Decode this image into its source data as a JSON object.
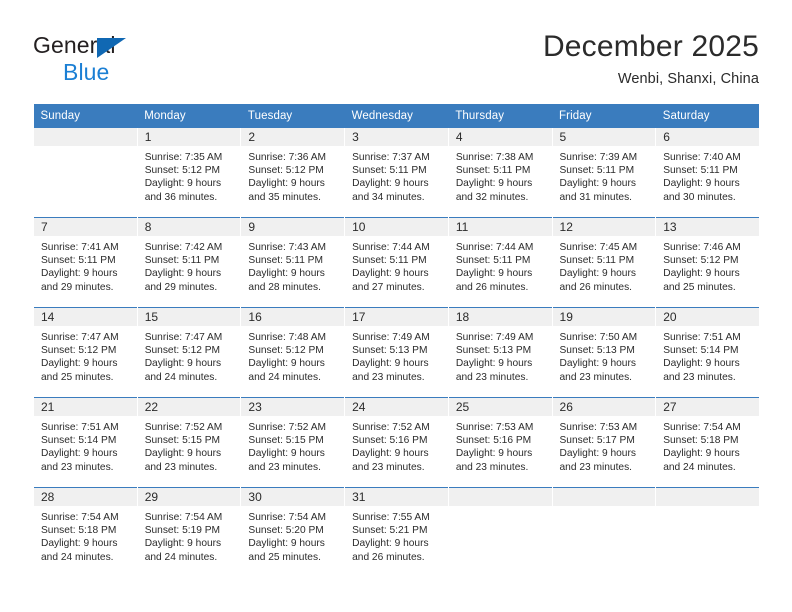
{
  "brand": {
    "line1": "General",
    "line2": "Blue",
    "triangle_color": "#1068b3",
    "text_color": "#231f20",
    "blue_color": "#1b7fd4"
  },
  "header": {
    "title": "December 2025",
    "subtitle": "Wenbi, Shanxi, China"
  },
  "theme": {
    "header_bg": "#3a7cbe",
    "header_text": "#ffffff",
    "daynum_bg": "#f0f0f0",
    "body_text": "#2b2b2b"
  },
  "weekday_headers": [
    "Sunday",
    "Monday",
    "Tuesday",
    "Wednesday",
    "Thursday",
    "Friday",
    "Saturday"
  ],
  "weeks": [
    [
      {
        "day": "",
        "empty": true,
        "sunrise": "",
        "sunset": "",
        "daylight_line1": "",
        "daylight_line2": ""
      },
      {
        "day": "1",
        "sunrise": "Sunrise: 7:35 AM",
        "sunset": "Sunset: 5:12 PM",
        "daylight_line1": "Daylight: 9 hours",
        "daylight_line2": "and 36 minutes."
      },
      {
        "day": "2",
        "sunrise": "Sunrise: 7:36 AM",
        "sunset": "Sunset: 5:12 PM",
        "daylight_line1": "Daylight: 9 hours",
        "daylight_line2": "and 35 minutes."
      },
      {
        "day": "3",
        "sunrise": "Sunrise: 7:37 AM",
        "sunset": "Sunset: 5:11 PM",
        "daylight_line1": "Daylight: 9 hours",
        "daylight_line2": "and 34 minutes."
      },
      {
        "day": "4",
        "sunrise": "Sunrise: 7:38 AM",
        "sunset": "Sunset: 5:11 PM",
        "daylight_line1": "Daylight: 9 hours",
        "daylight_line2": "and 32 minutes."
      },
      {
        "day": "5",
        "sunrise": "Sunrise: 7:39 AM",
        "sunset": "Sunset: 5:11 PM",
        "daylight_line1": "Daylight: 9 hours",
        "daylight_line2": "and 31 minutes."
      },
      {
        "day": "6",
        "sunrise": "Sunrise: 7:40 AM",
        "sunset": "Sunset: 5:11 PM",
        "daylight_line1": "Daylight: 9 hours",
        "daylight_line2": "and 30 minutes."
      }
    ],
    [
      {
        "day": "7",
        "sunrise": "Sunrise: 7:41 AM",
        "sunset": "Sunset: 5:11 PM",
        "daylight_line1": "Daylight: 9 hours",
        "daylight_line2": "and 29 minutes."
      },
      {
        "day": "8",
        "sunrise": "Sunrise: 7:42 AM",
        "sunset": "Sunset: 5:11 PM",
        "daylight_line1": "Daylight: 9 hours",
        "daylight_line2": "and 29 minutes."
      },
      {
        "day": "9",
        "sunrise": "Sunrise: 7:43 AM",
        "sunset": "Sunset: 5:11 PM",
        "daylight_line1": "Daylight: 9 hours",
        "daylight_line2": "and 28 minutes."
      },
      {
        "day": "10",
        "sunrise": "Sunrise: 7:44 AM",
        "sunset": "Sunset: 5:11 PM",
        "daylight_line1": "Daylight: 9 hours",
        "daylight_line2": "and 27 minutes."
      },
      {
        "day": "11",
        "sunrise": "Sunrise: 7:44 AM",
        "sunset": "Sunset: 5:11 PM",
        "daylight_line1": "Daylight: 9 hours",
        "daylight_line2": "and 26 minutes."
      },
      {
        "day": "12",
        "sunrise": "Sunrise: 7:45 AM",
        "sunset": "Sunset: 5:11 PM",
        "daylight_line1": "Daylight: 9 hours",
        "daylight_line2": "and 26 minutes."
      },
      {
        "day": "13",
        "sunrise": "Sunrise: 7:46 AM",
        "sunset": "Sunset: 5:12 PM",
        "daylight_line1": "Daylight: 9 hours",
        "daylight_line2": "and 25 minutes."
      }
    ],
    [
      {
        "day": "14",
        "sunrise": "Sunrise: 7:47 AM",
        "sunset": "Sunset: 5:12 PM",
        "daylight_line1": "Daylight: 9 hours",
        "daylight_line2": "and 25 minutes."
      },
      {
        "day": "15",
        "sunrise": "Sunrise: 7:47 AM",
        "sunset": "Sunset: 5:12 PM",
        "daylight_line1": "Daylight: 9 hours",
        "daylight_line2": "and 24 minutes."
      },
      {
        "day": "16",
        "sunrise": "Sunrise: 7:48 AM",
        "sunset": "Sunset: 5:12 PM",
        "daylight_line1": "Daylight: 9 hours",
        "daylight_line2": "and 24 minutes."
      },
      {
        "day": "17",
        "sunrise": "Sunrise: 7:49 AM",
        "sunset": "Sunset: 5:13 PM",
        "daylight_line1": "Daylight: 9 hours",
        "daylight_line2": "and 23 minutes."
      },
      {
        "day": "18",
        "sunrise": "Sunrise: 7:49 AM",
        "sunset": "Sunset: 5:13 PM",
        "daylight_line1": "Daylight: 9 hours",
        "daylight_line2": "and 23 minutes."
      },
      {
        "day": "19",
        "sunrise": "Sunrise: 7:50 AM",
        "sunset": "Sunset: 5:13 PM",
        "daylight_line1": "Daylight: 9 hours",
        "daylight_line2": "and 23 minutes."
      },
      {
        "day": "20",
        "sunrise": "Sunrise: 7:51 AM",
        "sunset": "Sunset: 5:14 PM",
        "daylight_line1": "Daylight: 9 hours",
        "daylight_line2": "and 23 minutes."
      }
    ],
    [
      {
        "day": "21",
        "sunrise": "Sunrise: 7:51 AM",
        "sunset": "Sunset: 5:14 PM",
        "daylight_line1": "Daylight: 9 hours",
        "daylight_line2": "and 23 minutes."
      },
      {
        "day": "22",
        "sunrise": "Sunrise: 7:52 AM",
        "sunset": "Sunset: 5:15 PM",
        "daylight_line1": "Daylight: 9 hours",
        "daylight_line2": "and 23 minutes."
      },
      {
        "day": "23",
        "sunrise": "Sunrise: 7:52 AM",
        "sunset": "Sunset: 5:15 PM",
        "daylight_line1": "Daylight: 9 hours",
        "daylight_line2": "and 23 minutes."
      },
      {
        "day": "24",
        "sunrise": "Sunrise: 7:52 AM",
        "sunset": "Sunset: 5:16 PM",
        "daylight_line1": "Daylight: 9 hours",
        "daylight_line2": "and 23 minutes."
      },
      {
        "day": "25",
        "sunrise": "Sunrise: 7:53 AM",
        "sunset": "Sunset: 5:16 PM",
        "daylight_line1": "Daylight: 9 hours",
        "daylight_line2": "and 23 minutes."
      },
      {
        "day": "26",
        "sunrise": "Sunrise: 7:53 AM",
        "sunset": "Sunset: 5:17 PM",
        "daylight_line1": "Daylight: 9 hours",
        "daylight_line2": "and 23 minutes."
      },
      {
        "day": "27",
        "sunrise": "Sunrise: 7:54 AM",
        "sunset": "Sunset: 5:18 PM",
        "daylight_line1": "Daylight: 9 hours",
        "daylight_line2": "and 24 minutes."
      }
    ],
    [
      {
        "day": "28",
        "sunrise": "Sunrise: 7:54 AM",
        "sunset": "Sunset: 5:18 PM",
        "daylight_line1": "Daylight: 9 hours",
        "daylight_line2": "and 24 minutes."
      },
      {
        "day": "29",
        "sunrise": "Sunrise: 7:54 AM",
        "sunset": "Sunset: 5:19 PM",
        "daylight_line1": "Daylight: 9 hours",
        "daylight_line2": "and 24 minutes."
      },
      {
        "day": "30",
        "sunrise": "Sunrise: 7:54 AM",
        "sunset": "Sunset: 5:20 PM",
        "daylight_line1": "Daylight: 9 hours",
        "daylight_line2": "and 25 minutes."
      },
      {
        "day": "31",
        "sunrise": "Sunrise: 7:55 AM",
        "sunset": "Sunset: 5:21 PM",
        "daylight_line1": "Daylight: 9 hours",
        "daylight_line2": "and 26 minutes."
      },
      {
        "day": "",
        "empty": true,
        "sunrise": "",
        "sunset": "",
        "daylight_line1": "",
        "daylight_line2": ""
      },
      {
        "day": "",
        "empty": true,
        "sunrise": "",
        "sunset": "",
        "daylight_line1": "",
        "daylight_line2": ""
      },
      {
        "day": "",
        "empty": true,
        "sunrise": "",
        "sunset": "",
        "daylight_line1": "",
        "daylight_line2": ""
      }
    ]
  ]
}
